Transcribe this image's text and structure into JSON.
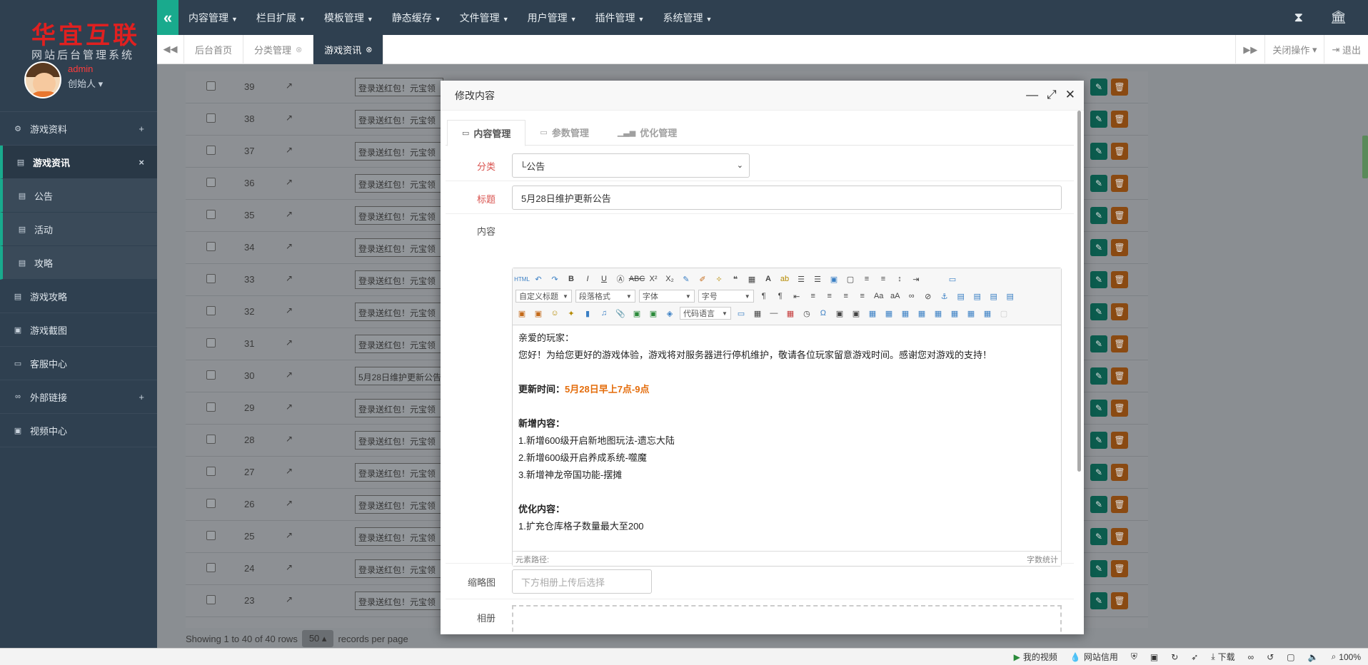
{
  "sidebar": {
    "brand": "华宜互联",
    "subtitle": "网站后台管理系统",
    "user": {
      "name": "admin",
      "role": "创始人"
    },
    "items": [
      {
        "label": "游戏资料",
        "icon": "gamepad-icon",
        "toggle": "+"
      },
      {
        "label": "游戏资讯",
        "icon": "newspaper-icon",
        "toggle": "×"
      },
      {
        "label": "公告",
        "icon": "newspaper-icon"
      },
      {
        "label": "活动",
        "icon": "newspaper-icon"
      },
      {
        "label": "攻略",
        "icon": "newspaper-icon"
      },
      {
        "label": "游戏攻略",
        "icon": "newspaper-icon"
      },
      {
        "label": "游戏截图",
        "icon": "image-icon"
      },
      {
        "label": "客服中心",
        "icon": "monitor-icon"
      },
      {
        "label": "外部链接",
        "icon": "link-icon",
        "toggle": "+"
      },
      {
        "label": "视频中心",
        "icon": "image-icon"
      }
    ]
  },
  "topbar": {
    "menus": [
      "内容管理",
      "栏目扩展",
      "模板管理",
      "静态缓存",
      "文件管理",
      "用户管理",
      "插件管理",
      "系统管理"
    ]
  },
  "tabs": {
    "items": [
      "后台首页",
      "分类管理",
      "游戏资讯"
    ],
    "close_ops": "关闭操作",
    "logout": "退出"
  },
  "grid": {
    "rows": [
      {
        "id": "39",
        "title": "登录送红包！元宝领"
      },
      {
        "id": "38",
        "title": "登录送红包！元宝领"
      },
      {
        "id": "37",
        "title": "登录送红包！元宝领"
      },
      {
        "id": "36",
        "title": "登录送红包！元宝领"
      },
      {
        "id": "35",
        "title": "登录送红包！元宝领"
      },
      {
        "id": "34",
        "title": "登录送红包！元宝领"
      },
      {
        "id": "33",
        "title": "登录送红包！元宝领"
      },
      {
        "id": "32",
        "title": "登录送红包！元宝领"
      },
      {
        "id": "31",
        "title": "登录送红包！元宝领"
      },
      {
        "id": "30",
        "title": "5月28日维护更新公告"
      },
      {
        "id": "29",
        "title": "登录送红包！元宝领"
      },
      {
        "id": "28",
        "title": "登录送红包！元宝领"
      },
      {
        "id": "27",
        "title": "登录送红包！元宝领"
      },
      {
        "id": "26",
        "title": "登录送红包！元宝领"
      },
      {
        "id": "25",
        "title": "登录送红包！元宝领"
      },
      {
        "id": "24",
        "title": "登录送红包！元宝领"
      },
      {
        "id": "23",
        "title": "登录送红包！元宝领"
      }
    ],
    "pager": {
      "showing": "Showing 1 to 40 of 40 rows",
      "per_page": "50",
      "suffix": "records per page"
    }
  },
  "modal": {
    "title": "修改内容",
    "tabs": [
      "内容管理",
      "参数管理",
      "优化管理"
    ],
    "fields": {
      "category_label": "分类",
      "category_value": "└公告",
      "title_label": "标题",
      "title_value": "5月28日维护更新公告",
      "content_label": "内容",
      "thumb_label": "缩略图",
      "thumb_placeholder": "下方相册上传后选择",
      "album_label": "相册"
    },
    "editor": {
      "selects": [
        "自定义标题",
        "段落格式",
        "字体",
        "字号",
        "代码语言"
      ],
      "footer_left": "元素路径:",
      "footer_right": "字数统计",
      "lines": [
        {
          "text": "亲爱的玩家：",
          "style": "normal"
        },
        {
          "text": "您好！为给您更好的游戏体验，游戏将对服务器进行停机维护，敬请各位玩家留意游戏时间。感谢您对游戏的支持！",
          "style": "normal"
        },
        {
          "text": "",
          "style": "normal"
        },
        {
          "text": "更新时间：",
          "highlight": "5月28日早上7点-9点",
          "style": "bold"
        },
        {
          "text": "",
          "style": "normal"
        },
        {
          "text": "新增内容：",
          "style": "bold"
        },
        {
          "text": "1.新增600级开启新地图玩法-遗忘大陆",
          "style": "normal"
        },
        {
          "text": "2.新增600级开启养成系统-噬魔",
          "style": "normal"
        },
        {
          "text": "3.新增神龙帝国功能-摆摊",
          "style": "normal"
        },
        {
          "text": "",
          "style": "normal"
        },
        {
          "text": "优化内容：",
          "style": "bold"
        },
        {
          "text": "1.扩充仓库格子数量最大至200",
          "style": "normal"
        }
      ]
    }
  },
  "statusbar": {
    "items": [
      "我的视频",
      "网站信用",
      "下载",
      "100%"
    ]
  },
  "colors": {
    "accent": "#19aa8d",
    "sidebar": "#2f4050",
    "highlight": "#e46c0a",
    "required": "#d9534f"
  }
}
